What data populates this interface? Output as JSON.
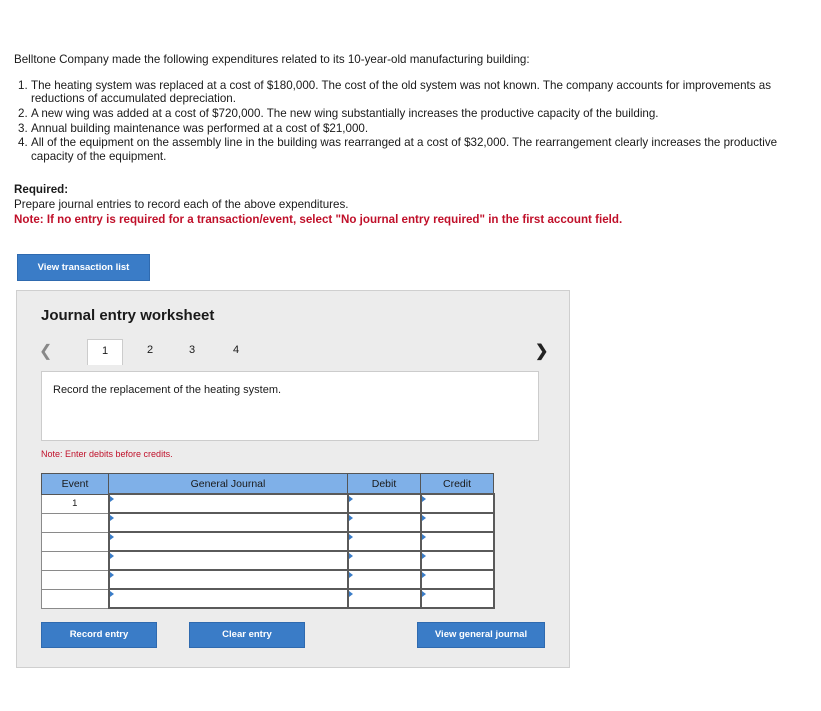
{
  "problem": {
    "intro": "Belltone Company made the following expenditures related to its 10-year-old manufacturing building:",
    "items": [
      {
        "num": "1.",
        "text": "The heating system was replaced at a cost of $180,000. The cost of the old system was not known. The company accounts for improvements as reductions of accumulated depreciation."
      },
      {
        "num": "2.",
        "text": "A new wing was added at a cost of $720,000. The new wing substantially increases the productive capacity of the building."
      },
      {
        "num": "3.",
        "text": "Annual building maintenance was performed at a cost of $21,000."
      },
      {
        "num": "4.",
        "text": "All of the equipment on the assembly line in the building was rearranged at a cost of $32,000. The rearrangement clearly increases the productive capacity of the equipment."
      }
    ],
    "required_heading": "Required:",
    "required_text": "Prepare journal entries to record each of the above expenditures.",
    "note": "Note: If no entry is required for a transaction/event, select \"No journal entry required\" in the first account field."
  },
  "buttons": {
    "view_transaction_list": "View transaction list",
    "record_entry": "Record entry",
    "clear_entry": "Clear entry",
    "view_general_journal": "View general journal"
  },
  "worksheet": {
    "title": "Journal entry worksheet",
    "tabs": [
      "1",
      "2",
      "3",
      "4"
    ],
    "active_tab": "1",
    "description": "Record the replacement of the heating system.",
    "enter_note": "Note: Enter debits before credits.",
    "columns": {
      "event": "Event",
      "account": "General Journal",
      "debit": "Debit",
      "credit": "Credit"
    },
    "rows": [
      {
        "event": "1",
        "account": "",
        "debit": "",
        "credit": ""
      },
      {
        "event": "",
        "account": "",
        "debit": "",
        "credit": ""
      },
      {
        "event": "",
        "account": "",
        "debit": "",
        "credit": ""
      },
      {
        "event": "",
        "account": "",
        "debit": "",
        "credit": ""
      },
      {
        "event": "",
        "account": "",
        "debit": "",
        "credit": ""
      },
      {
        "event": "",
        "account": "",
        "debit": "",
        "credit": ""
      }
    ]
  },
  "icons": {
    "prev": "chevron-left-icon",
    "next": "chevron-right-icon"
  },
  "colors": {
    "accent": "#3a7cc7",
    "header_blue": "#7fb0e8",
    "note_red": "#c0102a"
  }
}
